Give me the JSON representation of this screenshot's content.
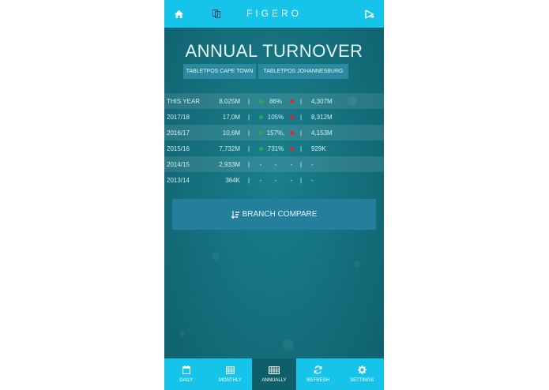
{
  "header": {
    "brand": "FIGERO",
    "home_icon": "home-icon",
    "copy_icon": "copy-icon",
    "logout_icon": "logout-icon"
  },
  "title": "ANNUAL TURNOVER",
  "location_tabs": [
    "TABLETPOS CAPE TOWN",
    "TABLETPOS JOHANNESBURG"
  ],
  "rows": [
    {
      "year": "THIS YEAR",
      "amount": "8,025M",
      "sep1": "|",
      "pct": "86%",
      "sep2": "|",
      "amount2": "4,307M",
      "dot1": "green",
      "dot2": "red"
    },
    {
      "year": "2017/18",
      "amount": "17,0M",
      "sep1": "|",
      "pct": "105%",
      "sep2": "|",
      "amount2": "8,312M",
      "dot1": "green",
      "dot2": "red"
    },
    {
      "year": "2016/17",
      "amount": "10,6M",
      "sep1": "|",
      "pct": "157%,",
      "sep2": "|",
      "amount2": "4,153M",
      "dot1": "green",
      "dot2": "red"
    },
    {
      "year": "2015/16",
      "amount": "7,732M",
      "sep1": "|",
      "pct": "731%",
      "sep2": "|",
      "amount2": "929K",
      "dot1": "green",
      "dot2": "red"
    },
    {
      "year": "2014/15",
      "amount": "2,933M",
      "sep1": "|",
      "pct": "-",
      "dash1": "-",
      "dash2": "-",
      "sep2": "|",
      "amount2": "-"
    },
    {
      "year": "2013/14",
      "amount": "364K",
      "sep1": "|",
      "pct": "-",
      "dash1": "-",
      "dash2": "-",
      "sep2": "|",
      "amount2": "-"
    }
  ],
  "compare_button": "BRANCH COMPARE",
  "bottom_nav": [
    {
      "label": "DAILY",
      "icon": "calendar-day-icon"
    },
    {
      "label": "MONTHLY",
      "icon": "calendar-month-icon"
    },
    {
      "label": "ANNUALLY",
      "icon": "calendar-year-icon"
    },
    {
      "label": "REFRESH",
      "icon": "refresh-icon"
    },
    {
      "label": "SETTINGS",
      "icon": "gear-icon"
    }
  ],
  "colors": {
    "accent": "#16c4ea",
    "background": "#146e7b",
    "active_tab": "#0e5f6a",
    "up": "#1db24a",
    "down": "#e2242d"
  }
}
